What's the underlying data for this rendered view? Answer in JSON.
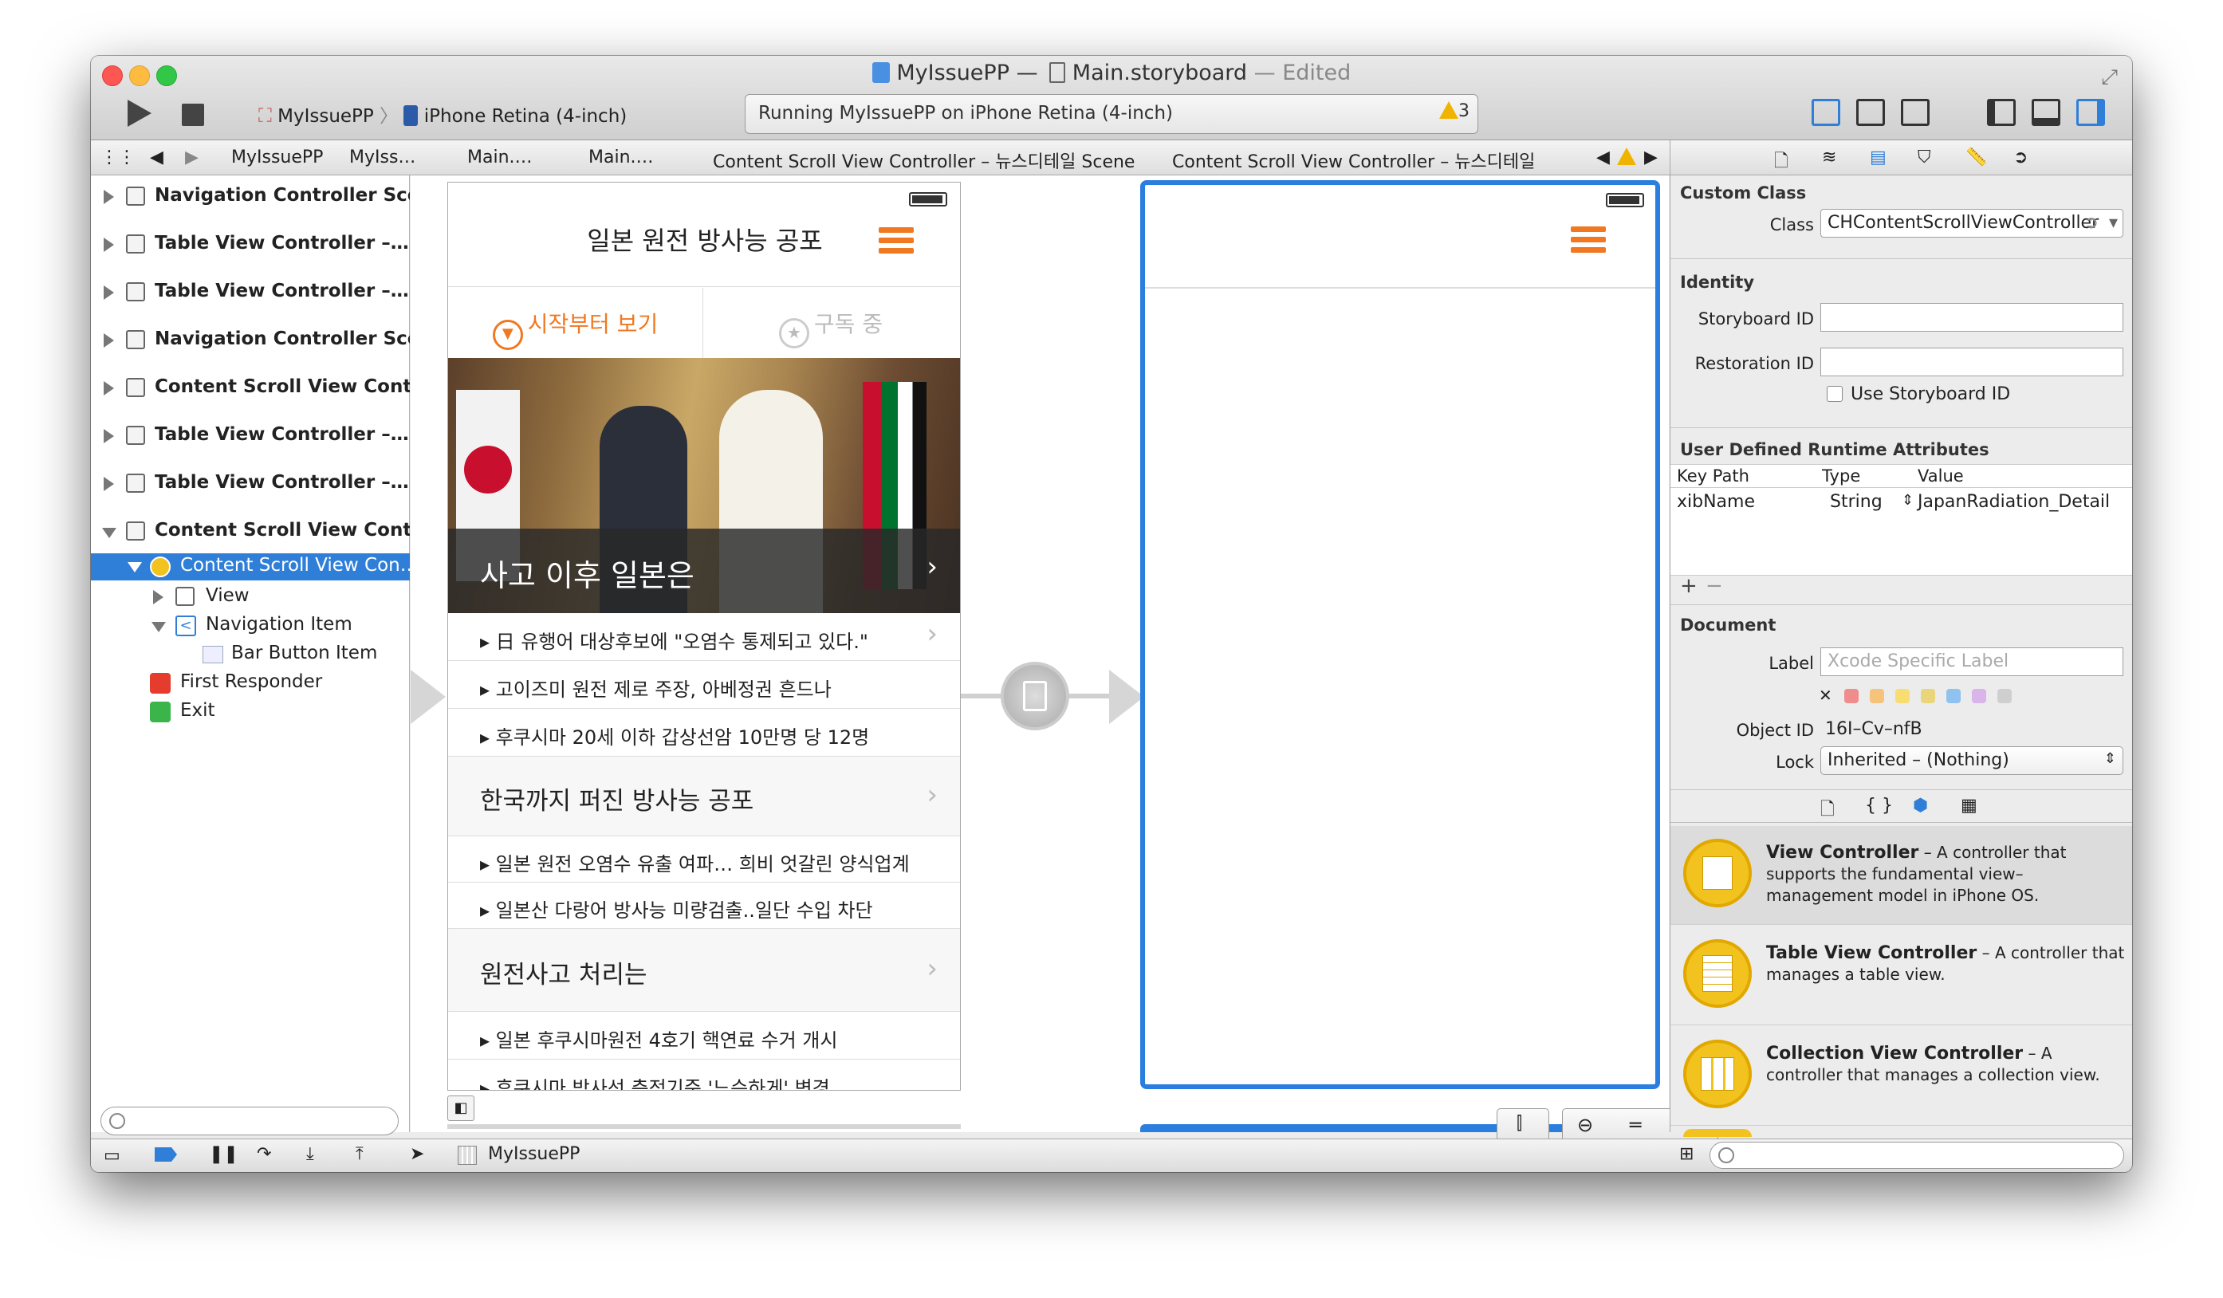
{
  "window": {
    "title_project": "MyIssuePP",
    "title_separator": "—",
    "title_file": "Main.storyboard",
    "title_edited": "— Edited"
  },
  "toolbar": {
    "scheme_project": "MyIssuePP",
    "scheme_device": "iPhone Retina (4-inch)",
    "activity_text": "Running MyIssuePP on iPhone Retina (4-inch)",
    "warnings_count": "3"
  },
  "jumpbar": {
    "items": [
      "MyIssuePP",
      "MyIss…",
      "Main.…",
      "Main.…",
      "Content Scroll View Controller – 뉴스디테일 Scene",
      "Content Scroll View Controller – 뉴스디테일"
    ]
  },
  "outline": {
    "scenes": [
      "Navigation Controller Scene",
      "Table View Controller –…",
      "Table View Controller –…",
      "Navigation Controller Scene",
      "Content Scroll View Cont…",
      "Table View Controller –…",
      "Table View Controller –…",
      "Content Scroll View Cont…"
    ],
    "selected": "Content Scroll View Con…",
    "children": [
      "View",
      "Navigation Item",
      "Bar Button Item",
      "First Responder",
      "Exit"
    ]
  },
  "phone": {
    "nav_title": "일본 원전 방사능 공포",
    "segment_left": "시작부터 보기",
    "segment_right": "구독 중",
    "photo_caption": "사고 이후 일본은",
    "list1": [
      "▸ 日 유행어 대상후보에 \"오염수 통제되고 있다.\"",
      "▸ 고이즈미 원전 제로 주장, 아베정권 흔드나",
      "▸ 후쿠시마 20세 이하 갑상선암 10만명 당 12명"
    ],
    "section2": "한국까지 퍼진 방사능 공포",
    "list2": [
      "▸ 일본 원전 오염수 유출 여파… 희비 엇갈린 양식업계",
      "▸ 일본산 다랑어 방사능 미량검출..일단 수입 차단"
    ],
    "section3": "원전사고 처리는",
    "list3": [
      "▸ 일본 후쿠시마원전 4호기 핵연료 수거 개시",
      "▸ 후쿠시마 방사선 측정기준 '느슨하게' 변경"
    ]
  },
  "inspector": {
    "custom_class": {
      "header": "Custom Class",
      "class_label": "Class",
      "class_value": "CHContentScrollViewController"
    },
    "identity": {
      "header": "Identity",
      "storyboard_id_label": "Storyboard ID",
      "restoration_id_label": "Restoration ID",
      "use_storyboard_id": "Use Storyboard ID"
    },
    "udra": {
      "header": "User Defined Runtime Attributes",
      "col_key": "Key Path",
      "col_type": "Type",
      "col_value": "Value",
      "row_key": "xibName",
      "row_type": "String",
      "row_value": "JapanRadiation_Detail",
      "add": "+",
      "remove": "−"
    },
    "document": {
      "header": "Document",
      "label_label": "Label",
      "label_placeholder": "Xcode Specific Label",
      "object_id_label": "Object ID",
      "object_id": "16I–Cv–nfB",
      "lock_label": "Lock",
      "lock_value": "Inherited – (Nothing)",
      "clear": "✕"
    },
    "library_tabs": [
      "{ }"
    ],
    "library": [
      {
        "title": "View Controller",
        "desc": " – A controller that supports the fundamental view–management model in iPhone OS."
      },
      {
        "title": "Table View Controller",
        "desc": " – A controller that manages a table view."
      },
      {
        "title": "Collection View Controller",
        "desc": " – A controller that manages a collection view."
      }
    ]
  },
  "debugbar": {
    "target": "MyIssuePP"
  },
  "colors": {
    "accent_orange": "#f07820",
    "selection_blue": "#2f7fd8",
    "frame_blue": "#2a7ee0"
  }
}
